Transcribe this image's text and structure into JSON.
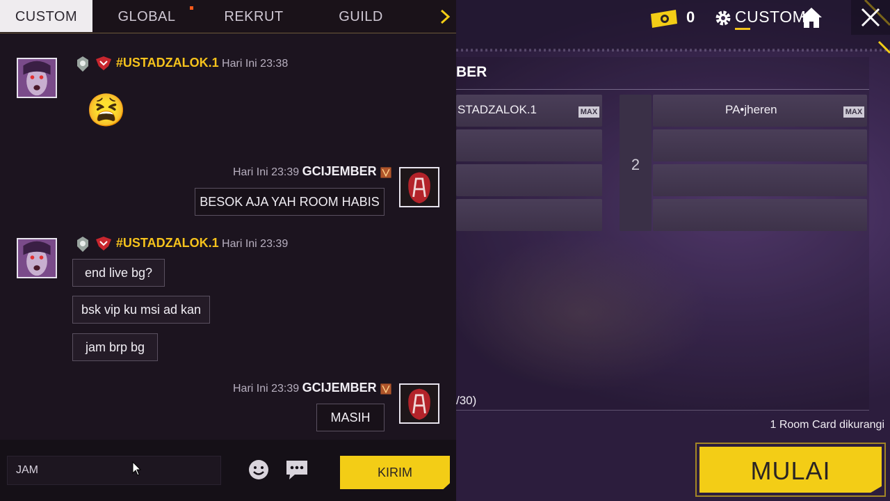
{
  "chat": {
    "tabs": [
      {
        "label": "CUSTOM",
        "active": true
      },
      {
        "label": "GLOBAL"
      },
      {
        "label": "REKRUT"
      },
      {
        "label": "GUILD"
      }
    ],
    "messages": [
      {
        "sender": "#USTADZALOK.1",
        "time": "Hari Ini 23:38",
        "content": "😫"
      },
      {
        "sender": "GCIJEMBER",
        "time": "Hari Ini 23:39",
        "content": "BESOK AJA YAH ROOM HABIS"
      },
      {
        "sender": "#USTADZALOK.1",
        "time": "Hari Ini 23:39",
        "lines": [
          "end live bg?",
          "bsk vip ku msi ad kan",
          "jam brp bg"
        ]
      },
      {
        "sender": "GCIJEMBER",
        "time": "Hari Ini 23:39",
        "content": "MASIH"
      }
    ],
    "input_value": "JAM",
    "send_label": "KIRIM"
  },
  "topbar": {
    "ticket_count": "0",
    "mode_label": "CUSTOM"
  },
  "room": {
    "section_title": "BER",
    "team1_slots": [
      "STADZALOK.1",
      "",
      "",
      ""
    ],
    "team2_number": "2",
    "team2_slots": [
      "PA•jheren",
      "",
      "",
      ""
    ],
    "max_label": "MAX",
    "counter": "/30)",
    "room_card_note": "1 Room Card dikurangi",
    "start_label": "MULAI"
  },
  "colors": {
    "accent_yellow": "#f3cd16",
    "name_gold": "#f6c31c",
    "chat_bg": "#1c141f",
    "room_purple": "#3e2a55"
  }
}
